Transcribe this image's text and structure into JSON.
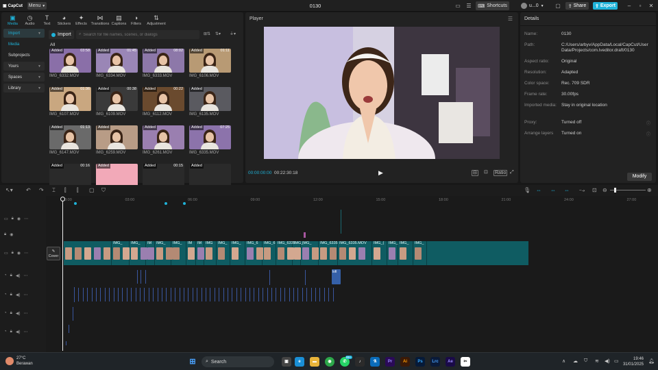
{
  "titlebar": {
    "logo": "CapCut",
    "menu": "Menu",
    "project_title": "0130",
    "shortcuts": "Shortcuts",
    "user": "u...0",
    "share": "Share",
    "export": "Export"
  },
  "tabs": [
    {
      "label": "Media",
      "icon": "media-icon"
    },
    {
      "label": "Audio",
      "icon": "audio-icon"
    },
    {
      "label": "Text",
      "icon": "text-icon"
    },
    {
      "label": "Stickers",
      "icon": "stickers-icon"
    },
    {
      "label": "Effects",
      "icon": "effects-icon"
    },
    {
      "label": "Transitions",
      "icon": "transitions-icon"
    },
    {
      "label": "Captions",
      "icon": "captions-icon"
    },
    {
      "label": "Filters",
      "icon": "filters-icon"
    },
    {
      "label": "Adjustment",
      "icon": "adjustment-icon"
    }
  ],
  "sidebar": {
    "import": "Import",
    "media": "Media",
    "subprojects": "Subprojects",
    "yours": "Yours",
    "spaces": "Spaces",
    "library": "Library"
  },
  "media": {
    "import_btn": "Import",
    "search_placeholder": "Search for file names, scenes, or dialogs",
    "all": "All",
    "added": "Added",
    "items": [
      {
        "name": "IMG_6332.MOV",
        "dur": "03:58",
        "bg": "#8a6fa8"
      },
      {
        "name": "IMG_6334.MOV",
        "dur": "01:45",
        "bg": "#9a86b6"
      },
      {
        "name": "IMG_6333.MOV",
        "dur": "08:02",
        "bg": "#8d78a9"
      },
      {
        "name": "IMG_6106.MOV",
        "dur": "01:11",
        "bg": "#b89a74"
      },
      {
        "name": "IMG_6107.MOV",
        "dur": "01:36",
        "bg": "#c9a780"
      },
      {
        "name": "IMG_6109.MOV",
        "dur": "00:38",
        "bg": "#3a3a3a"
      },
      {
        "name": "IMG_6112.MOV",
        "dur": "00:22",
        "bg": "#6a4a2e"
      },
      {
        "name": "IMG_6135.MOV",
        "dur": "",
        "bg": "#5a5a60"
      },
      {
        "name": "IMG_6147.MOV",
        "dur": "01:13",
        "bg": "#6a6a6a"
      },
      {
        "name": "IMG_6259.MOV",
        "dur": "",
        "bg": "#b89c86"
      },
      {
        "name": "IMG_6261.MOV",
        "dur": "",
        "bg": "#9a7fb0"
      },
      {
        "name": "IMG_6335.MOV",
        "dur": "07:25",
        "bg": "#8c73ab"
      },
      {
        "name": "",
        "dur": "00:16",
        "bg": "#2a2a2a"
      },
      {
        "name": "",
        "dur": "",
        "bg": "#f2a9b8"
      },
      {
        "name": "",
        "dur": "00:15",
        "bg": "#2a2a2a"
      },
      {
        "name": "",
        "dur": "",
        "bg": "#2a2a2a"
      }
    ]
  },
  "player": {
    "title": "Player",
    "current_time": "00:00:00:00",
    "total_time": "00:22:30:18",
    "ratio": "Ratio"
  },
  "details": {
    "title": "Details",
    "rows": [
      {
        "k": "Name:",
        "v": "0130"
      },
      {
        "k": "Path:",
        "v": "C:/Users/arbyv/AppData/Local/CapCut/User Data/Projects/com.lveditor.draft/0130"
      },
      {
        "k": "Aspect ratio:",
        "v": "Original"
      },
      {
        "k": "Resolution:",
        "v": "Adapted"
      },
      {
        "k": "Color space:",
        "v": "Rec. 709 SDR"
      },
      {
        "k": "Frame rate:",
        "v": "30.00fps"
      },
      {
        "k": "Imported media:",
        "v": "Stay in original location"
      },
      {
        "k": "Proxy:",
        "v": "Turned off"
      },
      {
        "k": "Arrange layers",
        "v": "Turned on"
      }
    ],
    "modify": "Modify"
  },
  "timeline": {
    "ticks": [
      "00:00",
      "03:00",
      "06:00",
      "09:00",
      "12:00",
      "15:00",
      "18:00",
      "21:00",
      "24:00",
      "27:00"
    ],
    "cover": "Cover",
    "clips": [
      {
        "label": "",
        "w": 70
      },
      {
        "label": "IMG_",
        "w": 26
      },
      {
        "label": "IMG_",
        "w": 24
      },
      {
        "label": "IM",
        "w": 13
      },
      {
        "label": "IMG_",
        "w": 24
      },
      {
        "label": "IMG_",
        "w": 22
      },
      {
        "label": "IM",
        "w": 14
      },
      {
        "label": "IM",
        "w": 12
      },
      {
        "label": "IMG",
        "w": 18
      },
      {
        "label": "IMG_",
        "w": 20
      },
      {
        "label": "IMG_",
        "w": 22
      },
      {
        "label": "IMG_6",
        "w": 25
      },
      {
        "label": "IMG_6",
        "w": 20
      },
      {
        "label": "IMG_6335",
        "w": 24
      },
      {
        "label": "IMG_",
        "w": 12
      },
      {
        "label": "IMG_",
        "w": 26
      },
      {
        "label": "IMG_6335",
        "w": 28
      },
      {
        "label": "IMG_6335.MOV",
        "w": 50
      },
      {
        "label": "IMG_(",
        "w": 22
      },
      {
        "label": "IMG_",
        "w": 16
      },
      {
        "label": "IMG_",
        "w": 22
      },
      {
        "label": "IMG_",
        "w": 20
      }
    ],
    "lofi": "lofi"
  },
  "taskbar": {
    "temp": "27°C",
    "weather": "Berawan",
    "search": "Search",
    "time": "19:46",
    "date": "31/01/2025",
    "badge": "99+"
  }
}
